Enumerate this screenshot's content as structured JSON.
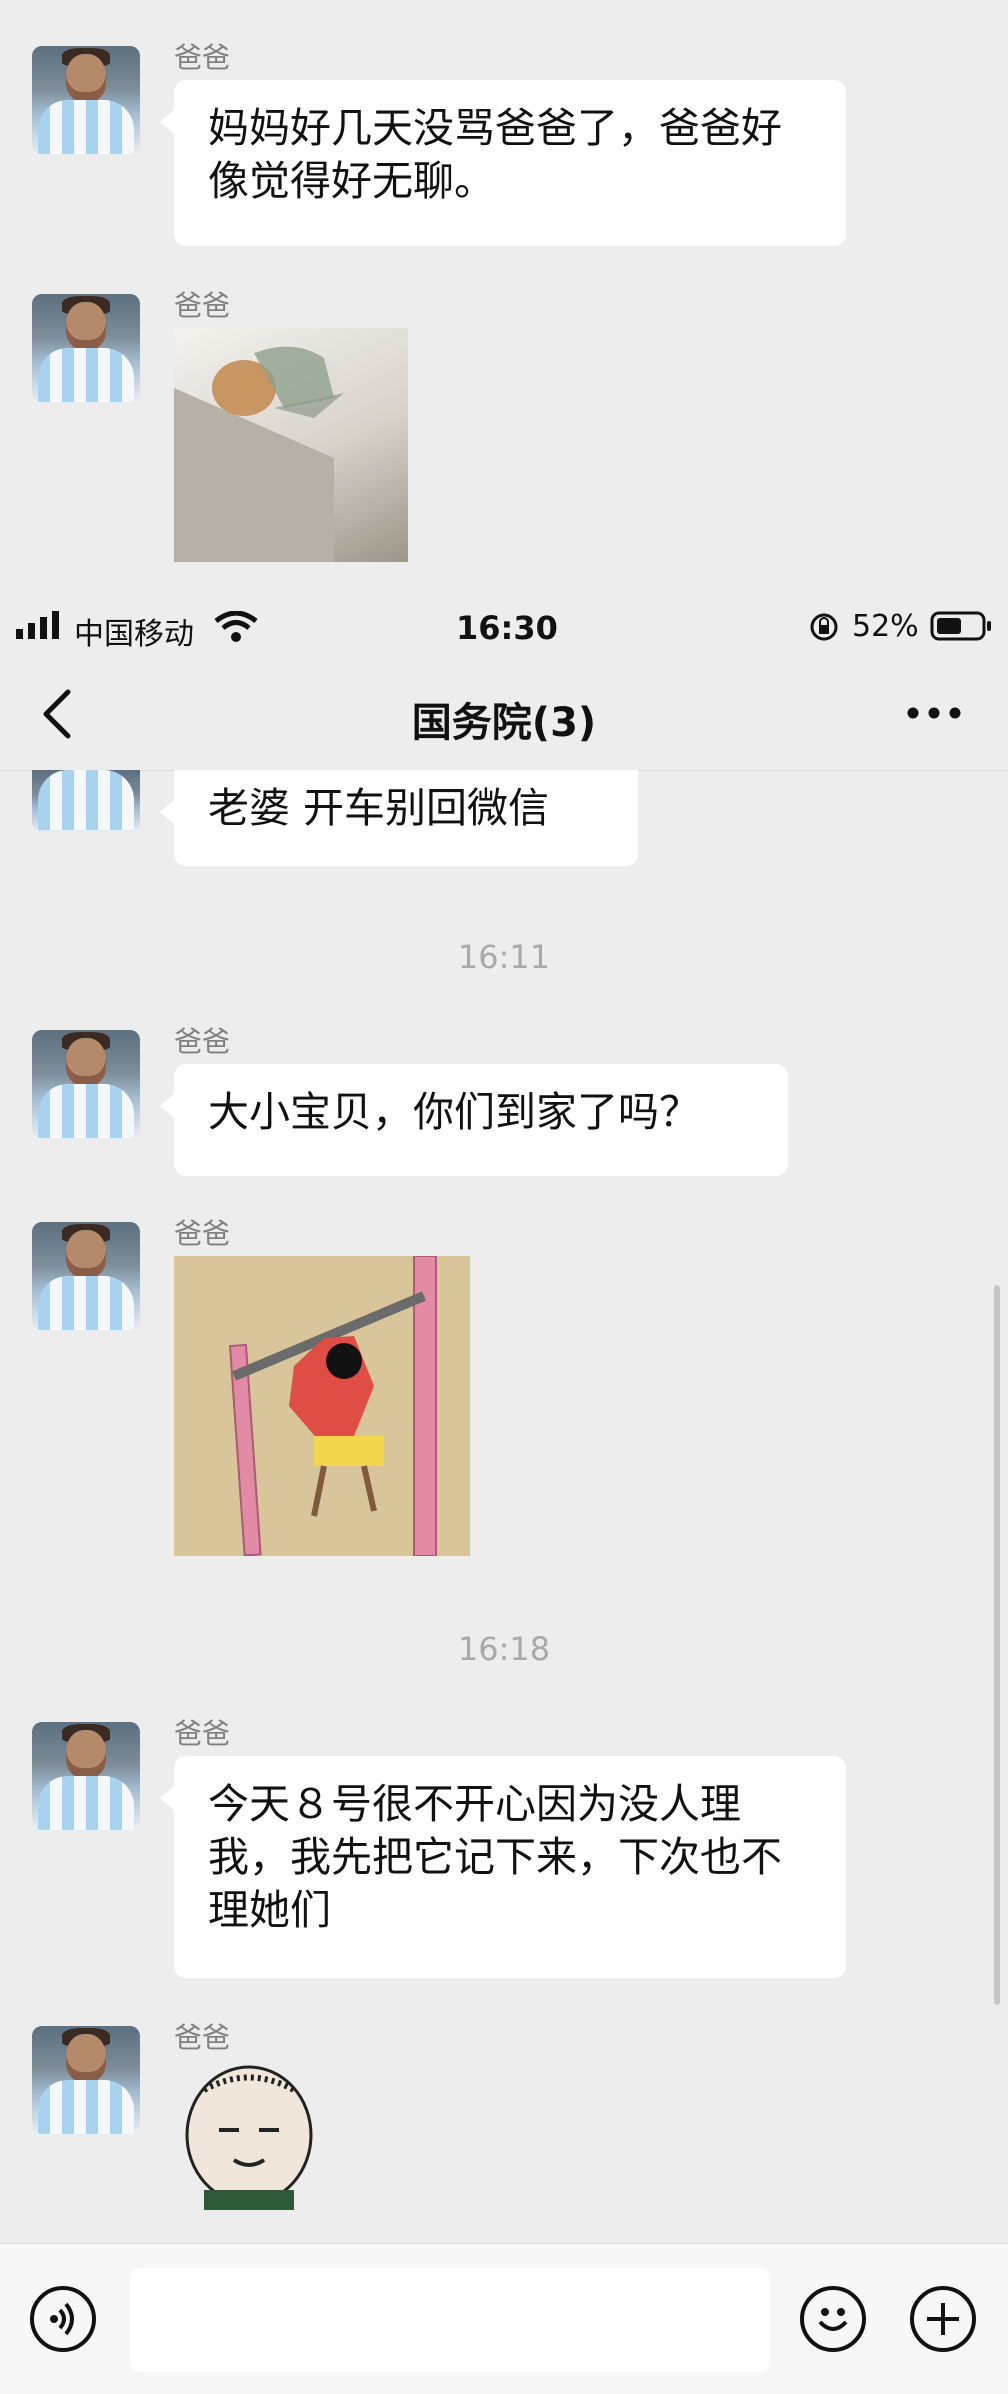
{
  "status_bar": {
    "carrier": "中国移动",
    "time": "16:30",
    "battery": "52%"
  },
  "nav": {
    "title": "国务院(3)",
    "back_icon": "chevron-left-icon",
    "more_icon": "more-icon"
  },
  "messages_top": [
    {
      "sender": "爸爸",
      "text": "妈妈好几天没骂爸爸了，爸爸好像觉得好无聊。"
    },
    {
      "sender": "爸爸",
      "image": "sticker"
    }
  ],
  "messages_main": [
    {
      "type": "text",
      "text": "老婆  开车别回微信"
    },
    {
      "type": "time",
      "text": "16:11"
    },
    {
      "type": "text",
      "sender": "爸爸",
      "text": "大小宝贝，你们到家了吗？"
    },
    {
      "type": "image",
      "sender": "爸爸"
    },
    {
      "type": "time",
      "text": "16:18"
    },
    {
      "type": "text",
      "sender": "爸爸",
      "text": "今天８号很不开心因为没人理我，我先把它记下来，下次也不理她们"
    },
    {
      "type": "image",
      "sender": "爸爸"
    }
  ],
  "input_bar": {
    "voice_icon": "voice-icon",
    "emoji_icon": "emoji-icon",
    "plus_icon": "plus-icon"
  },
  "colors": {
    "background": "#ededed",
    "bubble": "#ffffff",
    "nav_text": "#111111"
  }
}
